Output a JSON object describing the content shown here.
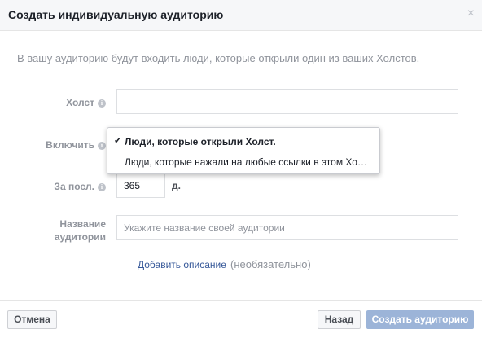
{
  "dialog": {
    "title": "Создать индивидуальную аудиторию",
    "close_glyph": "×"
  },
  "intro_text": "В вашу аудиторию будут входить люди, которые открыли один из ваших Холстов.",
  "form": {
    "canvas": {
      "label": "Холст",
      "value": ""
    },
    "include": {
      "label": "Включить",
      "options": [
        {
          "label": "Люди, которые открыли Холст.",
          "selected": true
        },
        {
          "label": "Люди, которые нажали на любые ссылки в этом Хо…",
          "selected": false
        }
      ]
    },
    "period": {
      "label": "За посл.",
      "value": "365",
      "unit": "д."
    },
    "audience_name": {
      "label_line1": "Название",
      "label_line2": "аудитории",
      "placeholder": "Укажите название своей аудитории"
    },
    "add_description_link": "Добавить описание",
    "optional_note": "(необязательно)"
  },
  "footer": {
    "cancel_label": "Отмена",
    "back_label": "Назад",
    "create_label": "Создать аудиторию"
  },
  "icons": {
    "info": "info-icon",
    "check": "checkmark-icon",
    "close": "close-icon"
  },
  "colors": {
    "link": "#365899",
    "primary_button_disabled": "#9cb4d8"
  }
}
